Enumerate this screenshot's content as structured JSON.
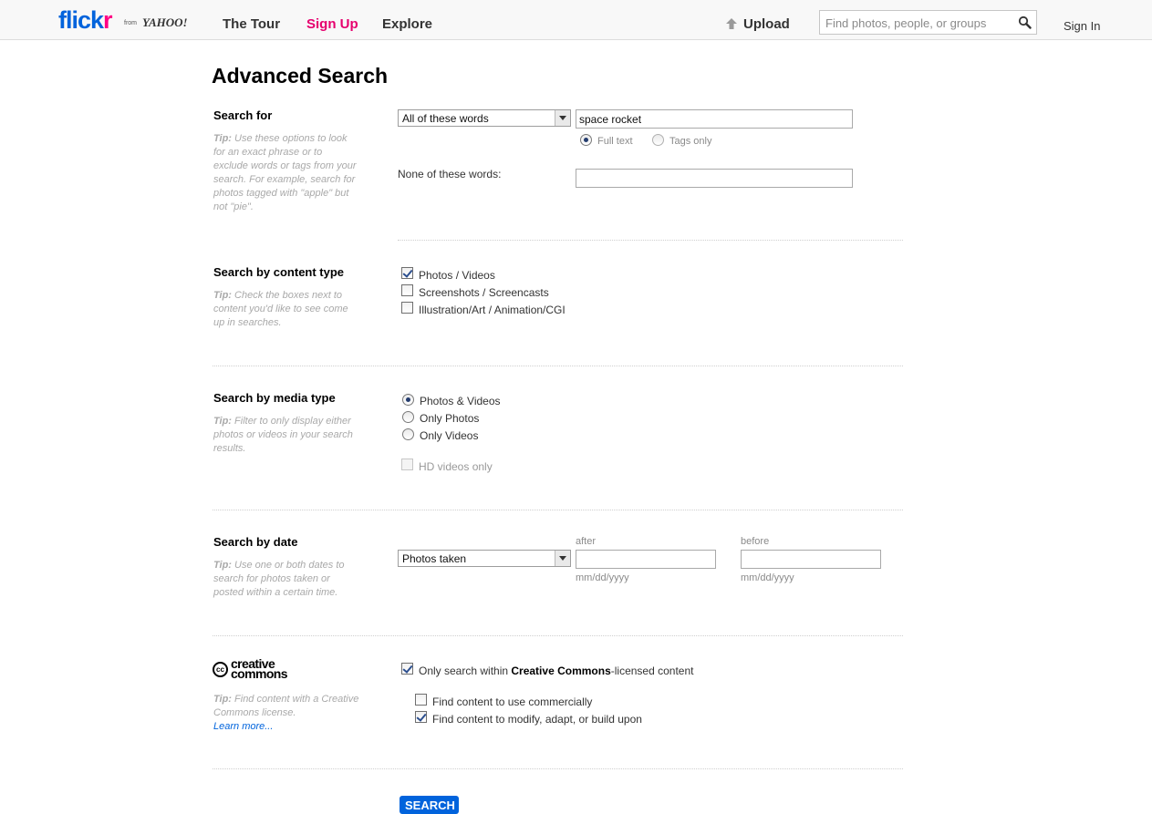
{
  "header": {
    "logo": {
      "flickr_part1": "flick",
      "flickr_part2": "r",
      "from": "from",
      "yahoo": "YAHOO!"
    },
    "nav": {
      "tour": "The Tour",
      "signup": "Sign Up",
      "explore": "Explore"
    },
    "upload_label": "Upload",
    "search_placeholder": "Find photos, people, or groups",
    "signin": "Sign In"
  },
  "page_title": "Advanced Search",
  "search_for": {
    "title": "Search for",
    "tip_prefix": "Tip:",
    "tip": " Use these options to look for an exact phrase or to exclude words or tags from your search. For example, search for photos tagged with \"apple\" but not \"pie\".",
    "match_select": "All of these words",
    "query_value": "space rocket",
    "radio_fulltext": "Full text",
    "radio_tags": "Tags only",
    "none_label": "None of these words:",
    "none_value": ""
  },
  "content_type": {
    "title": "Search by content type",
    "tip_prefix": "Tip:",
    "tip": " Check the boxes next to content you'd like to see come up in searches.",
    "opt1": "Photos / Videos",
    "opt2": "Screenshots / Screencasts",
    "opt3": "Illustration/Art / Animation/CGI"
  },
  "media_type": {
    "title": "Search by media type",
    "tip_prefix": "Tip:",
    "tip": " Filter to only display either photos or videos in your search results.",
    "opt1": "Photos & Videos",
    "opt2": "Only Photos",
    "opt3": "Only Videos",
    "hd": "HD videos only"
  },
  "date": {
    "title": "Search by date",
    "tip_prefix": "Tip:",
    "tip": " Use one or both dates to search for photos taken or posted within a certain time.",
    "select": "Photos taken",
    "after_label": "after",
    "before_label": "before",
    "after_value": "",
    "before_value": "",
    "format_hint": "mm/dd/yyyy"
  },
  "cc": {
    "logo_symbol": "cc",
    "logo_line1": "creative",
    "logo_line2": "commons",
    "tip_prefix": "Tip:",
    "tip": " Find content with a Creative Commons license.",
    "learn_more": "Learn more...",
    "only_cc_pre": "Only search within ",
    "only_cc_bold": "Creative Commons",
    "only_cc_post": "-licensed content",
    "commercial": "Find content to use commercially",
    "modify": "Find content to modify, adapt, or build upon"
  },
  "search_button": "SEARCH",
  "colors": {
    "flickr_blue": "#0063dc",
    "flickr_pink": "#ff0084",
    "signup_pink": "#e6006e"
  }
}
